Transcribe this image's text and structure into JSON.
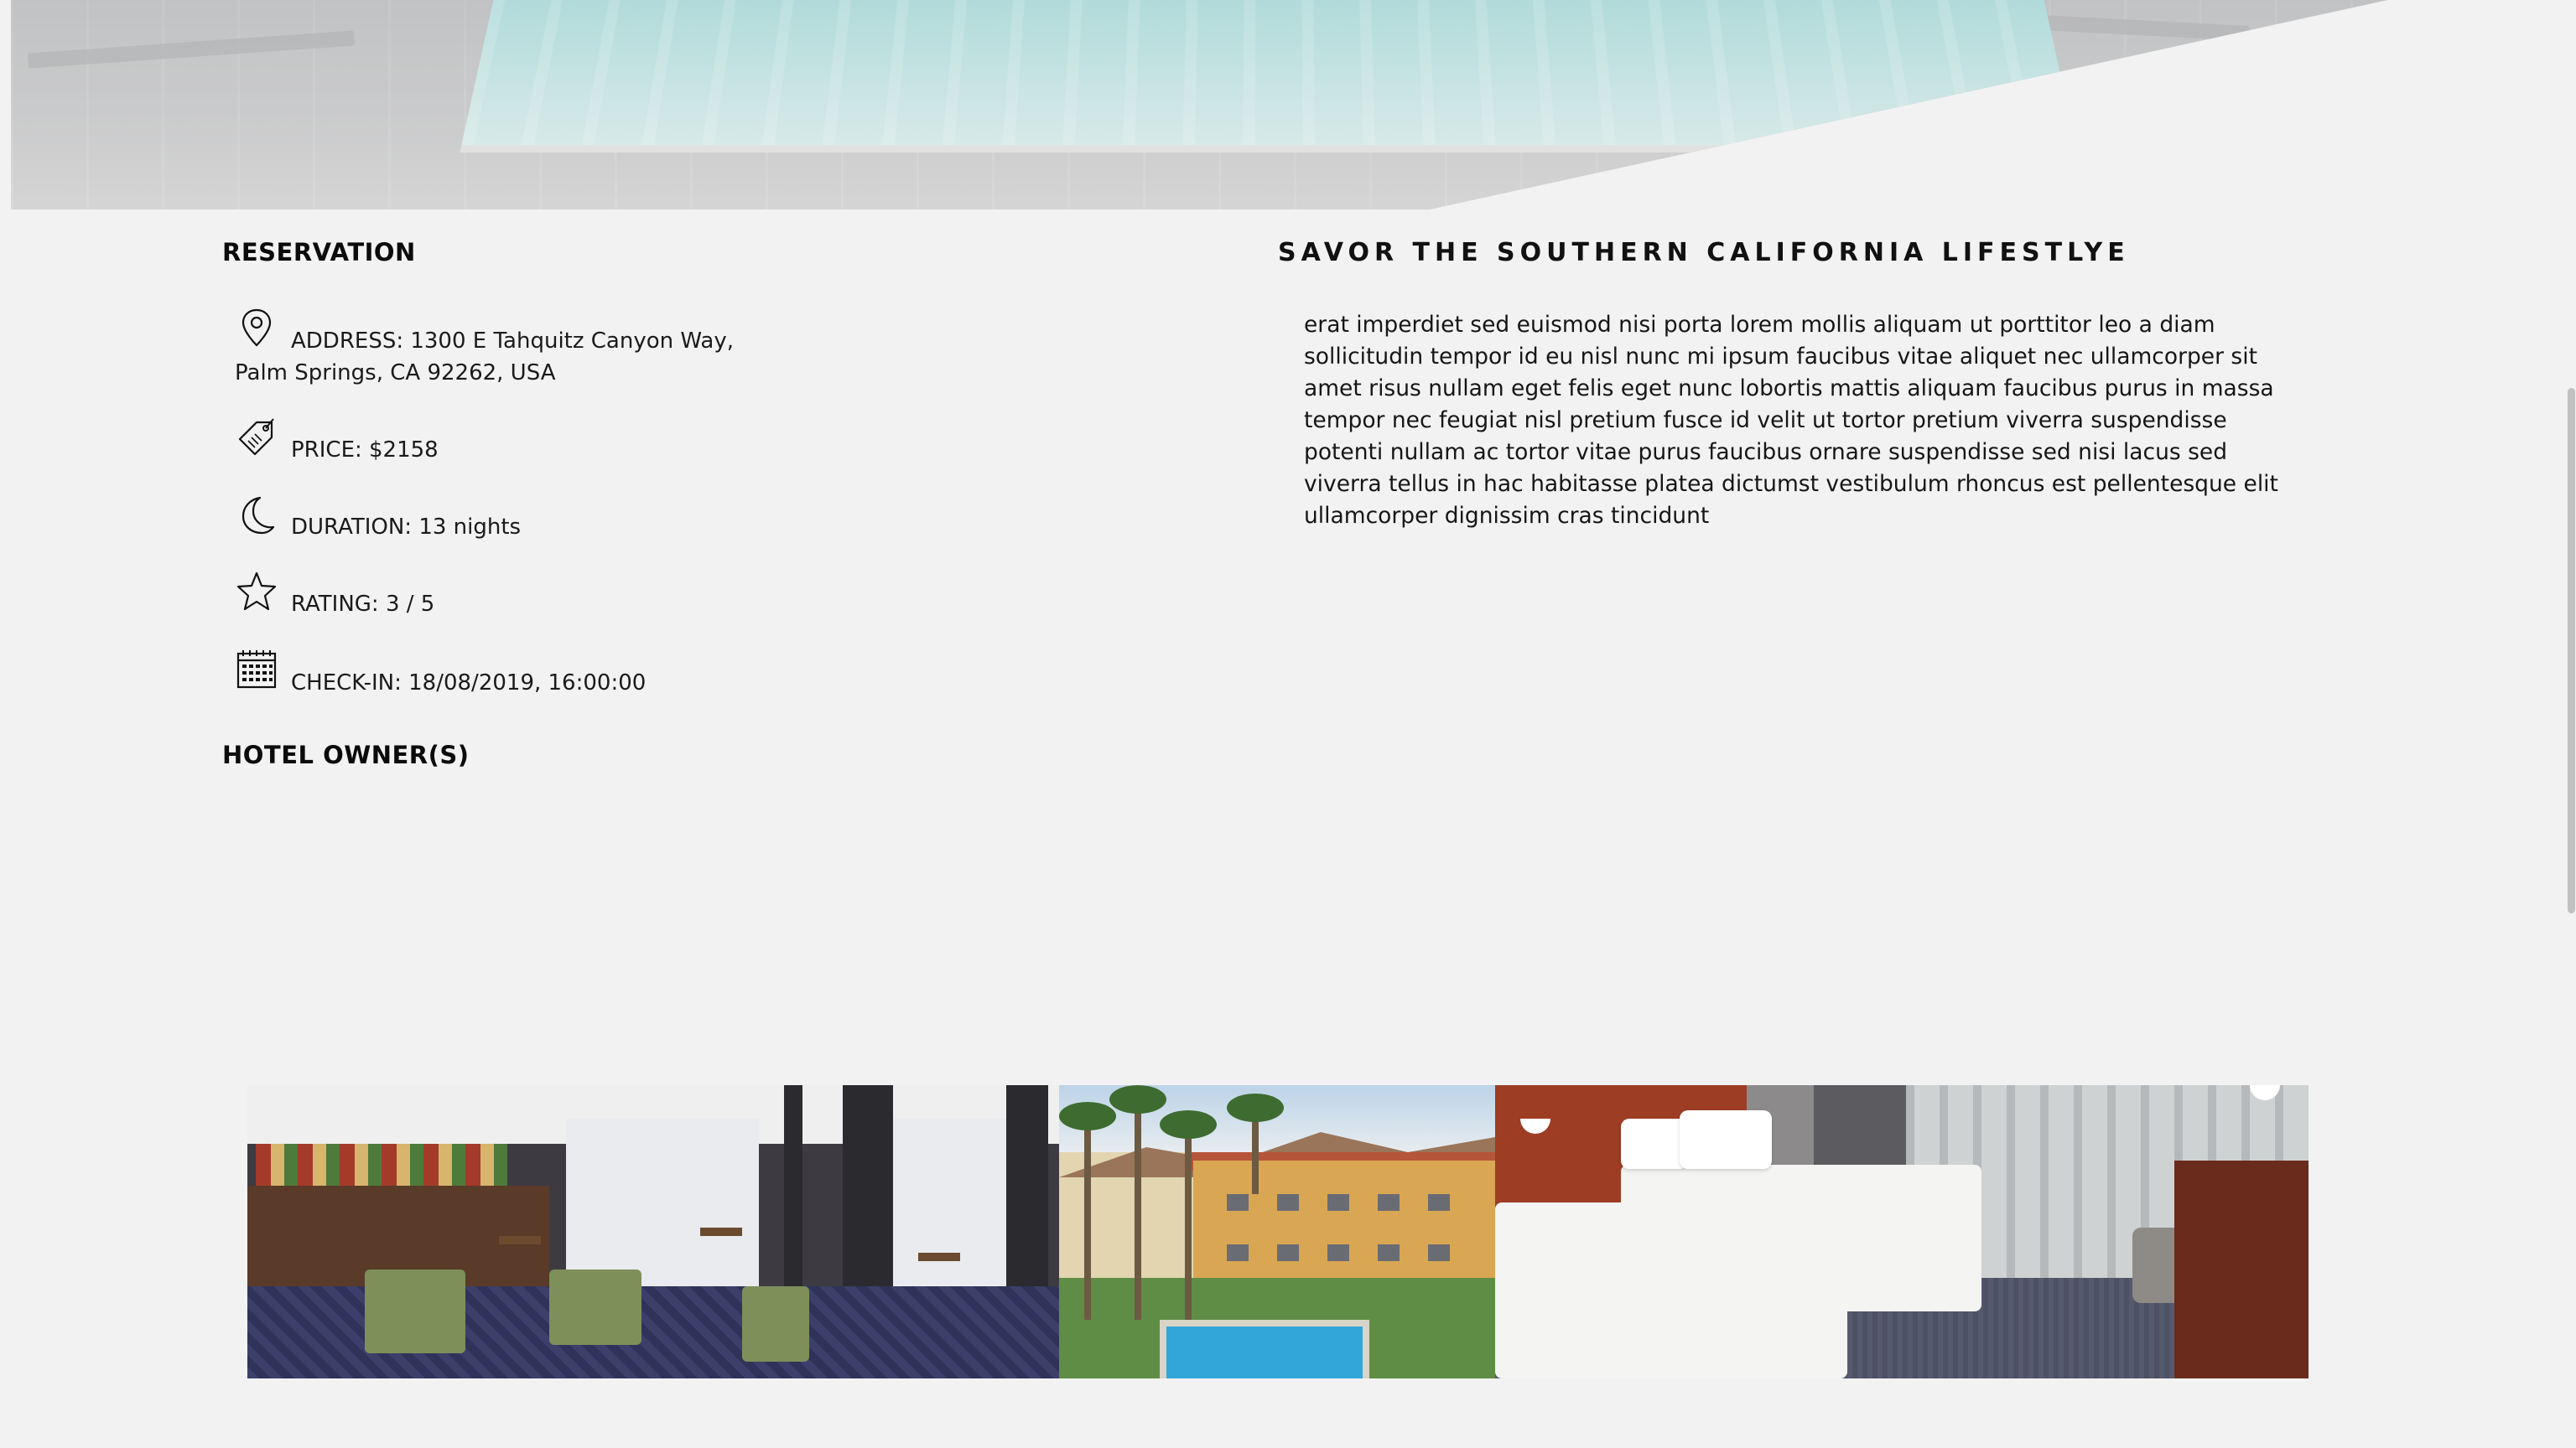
{
  "reservation": {
    "title": "RESERVATION",
    "address_line1": "ADDRESS: 1300 E Tahquitz Canyon Way,",
    "address_line2": "Palm Springs, CA 92262, USA",
    "price": "PRICE: $2158",
    "duration": "DURATION: 13 nights",
    "rating": "RATING: 3 / 5",
    "checkin": "CHECK-IN: 18/08/2019, 16:00:00",
    "icons": [
      "location-pin-icon",
      "price-tag-icon",
      "moon-icon",
      "star-icon",
      "calendar-icon"
    ]
  },
  "owners": {
    "title": "HOTEL OWNER(S)"
  },
  "lifestyle": {
    "title": "SAVOR THE SOUTHERN CALIFORNIA LIFESTLYE",
    "body": "erat imperdiet sed euismod nisi porta lorem mollis aliquam ut porttitor leo a diam sollicitudin tempor id eu nisl nunc mi ipsum faucibus vitae aliquet nec ullamcorper sit amet risus nullam eget felis eget nunc lobortis mattis aliquam faucibus purus in massa tempor nec feugiat nisl pretium fusce id velit ut tortor pretium viverra suspendisse potenti nullam ac tortor vitae purus faucibus ornare suspendisse sed nisi lacus sed viverra tellus in hac habitasse platea dictumst vestibulum rhoncus est pellentesque elit ullamcorper dignissim cras tincidunt"
  },
  "colors": {
    "background": "#f2f2f2",
    "text": "#111111",
    "pool": "#9ed6d5"
  }
}
